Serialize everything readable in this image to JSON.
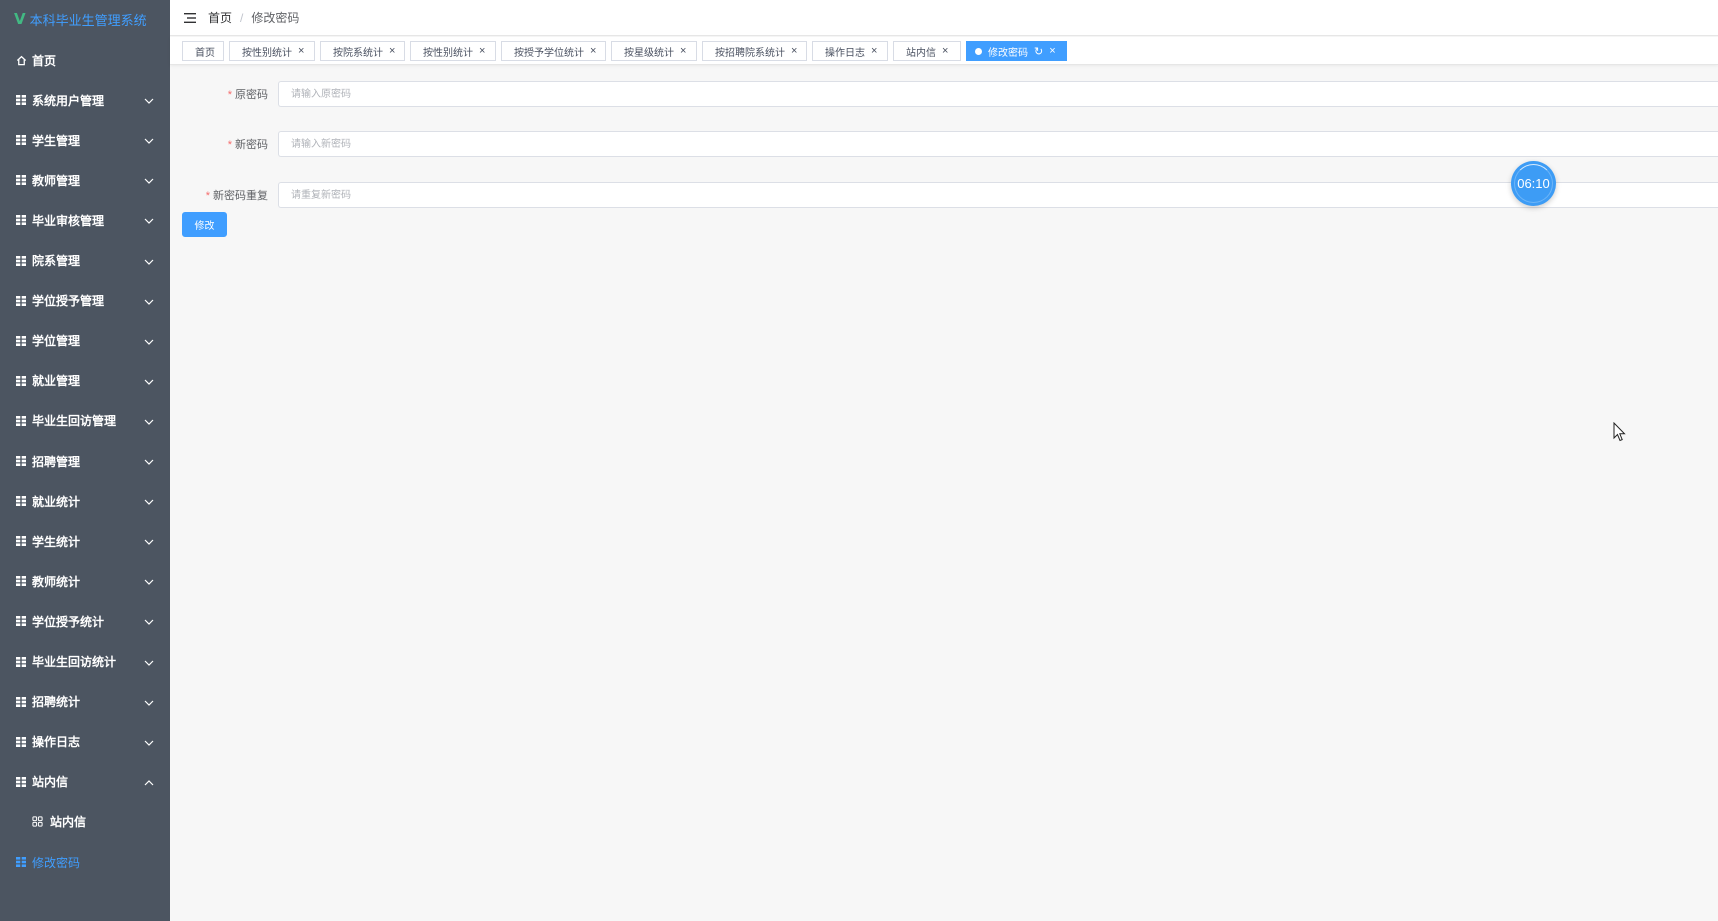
{
  "app": {
    "title": "本科毕业生管理系统",
    "logo_mark": "V"
  },
  "sidebar": {
    "items": [
      {
        "label": "首页",
        "icon": "home-icon",
        "arrow": "none"
      },
      {
        "label": "系统用户管理",
        "icon": "grid-icon",
        "arrow": "down"
      },
      {
        "label": "学生管理",
        "icon": "grid-icon",
        "arrow": "down"
      },
      {
        "label": "教师管理",
        "icon": "grid-icon",
        "arrow": "down"
      },
      {
        "label": "毕业审核管理",
        "icon": "grid-icon",
        "arrow": "down"
      },
      {
        "label": "院系管理",
        "icon": "grid-icon",
        "arrow": "down"
      },
      {
        "label": "学位授予管理",
        "icon": "grid-icon",
        "arrow": "down"
      },
      {
        "label": "学位管理",
        "icon": "grid-icon",
        "arrow": "down"
      },
      {
        "label": "就业管理",
        "icon": "grid-icon",
        "arrow": "down"
      },
      {
        "label": "毕业生回访管理",
        "icon": "grid-icon",
        "arrow": "down"
      },
      {
        "label": "招聘管理",
        "icon": "grid-icon",
        "arrow": "down"
      },
      {
        "label": "就业统计",
        "icon": "grid-icon",
        "arrow": "down"
      },
      {
        "label": "学生统计",
        "icon": "grid-icon",
        "arrow": "down"
      },
      {
        "label": "教师统计",
        "icon": "grid-icon",
        "arrow": "down"
      },
      {
        "label": "学位授予统计",
        "icon": "grid-icon",
        "arrow": "down"
      },
      {
        "label": "毕业生回访统计",
        "icon": "grid-icon",
        "arrow": "down"
      },
      {
        "label": "招聘统计",
        "icon": "grid-icon",
        "arrow": "down"
      },
      {
        "label": "操作日志",
        "icon": "grid-icon",
        "arrow": "down"
      },
      {
        "label": "站内信",
        "icon": "grid-icon",
        "arrow": "up"
      },
      {
        "label": "站内信",
        "icon": "apps-icon",
        "arrow": "none",
        "sub": true
      },
      {
        "label": "修改密码",
        "icon": "grid-icon",
        "arrow": "none",
        "active": true
      }
    ]
  },
  "breadcrumb": {
    "home": "首页",
    "separator": "/",
    "current": "修改密码"
  },
  "tags": [
    {
      "label": "首页",
      "closable": false
    },
    {
      "label": "按性别统计",
      "closable": true
    },
    {
      "label": "按院系统计",
      "closable": true
    },
    {
      "label": "按性别统计",
      "closable": true
    },
    {
      "label": "按授予学位统计",
      "closable": true
    },
    {
      "label": "按星级统计",
      "closable": true
    },
    {
      "label": "按招聘院系统计",
      "closable": true
    },
    {
      "label": "操作日志",
      "closable": true
    },
    {
      "label": "站内信",
      "closable": true
    },
    {
      "label": "修改密码",
      "closable": true,
      "active": true
    }
  ],
  "form": {
    "old_password": {
      "label": "原密码",
      "placeholder": "请输入原密码",
      "required_mark": "*"
    },
    "new_password": {
      "label": "新密码",
      "placeholder": "请输入新密码",
      "required_mark": "*"
    },
    "repeat_password": {
      "label": "新密码重复",
      "placeholder": "请重复新密码",
      "required_mark": "*"
    },
    "submit_label": "修改"
  },
  "timer": {
    "text": "06:10"
  },
  "colors": {
    "sidebar_bg": "#4c5561",
    "accent": "#409eff",
    "logo_mark": "#42b983",
    "required": "#f56c6c"
  }
}
